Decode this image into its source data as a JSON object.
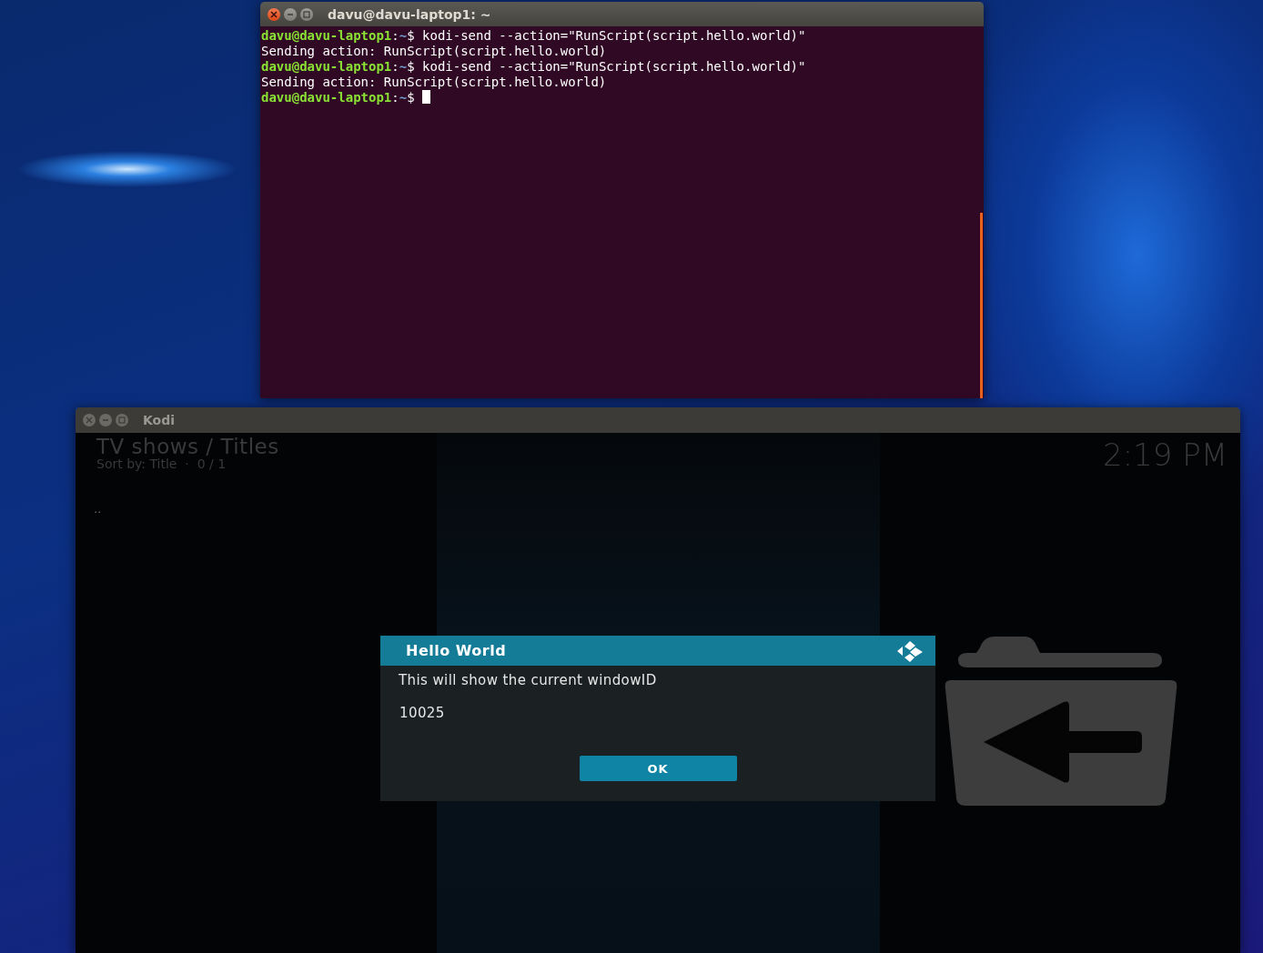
{
  "terminal": {
    "title": "davu@davu-laptop1: ~",
    "lines": [
      {
        "kind": "prompt",
        "user_host": "davu@davu-laptop1",
        "separator": ":",
        "path": "~",
        "symbol": "$",
        "command": "kodi-send --action=\"RunScript(script.hello.world)\"",
        "cursor": false
      },
      {
        "kind": "output",
        "text": "Sending action: RunScript(script.hello.world)"
      },
      {
        "kind": "prompt",
        "user_host": "davu@davu-laptop1",
        "separator": ":",
        "path": "~",
        "symbol": "$",
        "command": "kodi-send --action=\"RunScript(script.hello.world)\"",
        "cursor": false
      },
      {
        "kind": "output",
        "text": "Sending action: RunScript(script.hello.world)"
      },
      {
        "kind": "prompt",
        "user_host": "davu@davu-laptop1",
        "separator": ":",
        "path": "~",
        "symbol": "$",
        "cursor": true
      }
    ]
  },
  "kodi": {
    "title": "Kodi",
    "heading": "TV shows / Titles",
    "sort_info": "Sort by: Title  ·  0 / 1",
    "clock": "2:19 PM",
    "list_items": [
      ".."
    ],
    "dialog": {
      "title": "Hello World",
      "message": "This will show the current windowID",
      "value": "10025",
      "button": "OK"
    }
  }
}
